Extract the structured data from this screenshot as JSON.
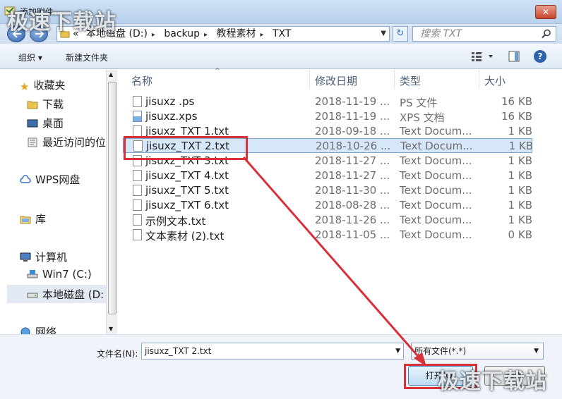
{
  "window": {
    "title": "添加附件",
    "close_label": "✕"
  },
  "address": {
    "overflow": "«",
    "crumbs": [
      "本地磁盘 (D:)",
      "backup",
      "教程素材",
      "TXT"
    ],
    "search_placeholder": "搜索 TXT"
  },
  "toolbar": {
    "organize": "组织 ▾",
    "new_folder": "新建文件夹"
  },
  "nav": {
    "favorites": "收藏夹",
    "downloads": "下载",
    "desktop": "桌面",
    "recent": "最近访问的位",
    "wps": "WPS网盘",
    "libraries": "库",
    "computer": "计算机",
    "drive_c": "Win7 (C:)",
    "drive_d": "本地磁盘 (D:",
    "network": "网络"
  },
  "columns": {
    "name": "名称",
    "date": "修改日期",
    "type": "类型",
    "size": "大小"
  },
  "files": [
    {
      "name": "jisuxz .ps",
      "date": "2018-11-19 ...",
      "type": "PS 文件",
      "size": "16 KB",
      "icon": "file-icon"
    },
    {
      "name": "jisuxz.xps",
      "date": "2018-11-19 ...",
      "type": "XPS 文档",
      "size": "16 KB",
      "icon": "image-file-icon"
    },
    {
      "name": "jisuxz_TXT 1.txt",
      "date": "2018-09-18 ...",
      "type": "Text Docum...",
      "size": "1 KB",
      "icon": "text-file-icon"
    },
    {
      "name": "jisuxz_TXT 2.txt",
      "date": "2018-10-26 ...",
      "type": "Text Docum...",
      "size": "1 KB",
      "icon": "text-file-icon"
    },
    {
      "name": "jisuxz_TXT 3.txt",
      "date": "2018-11-27 ...",
      "type": "Text Docum...",
      "size": "1 KB",
      "icon": "text-file-icon"
    },
    {
      "name": "jisuxz_TXT 4.txt",
      "date": "2018-11-27 ...",
      "type": "Text Docum...",
      "size": "1 KB",
      "icon": "text-file-icon"
    },
    {
      "name": "jisuxz_TXT 5.txt",
      "date": "2018-11-30 ...",
      "type": "Text Docum...",
      "size": "1 KB",
      "icon": "text-file-icon"
    },
    {
      "name": "jisuxz_TXT 6.txt",
      "date": "2018-08-28 ...",
      "type": "Text Docum...",
      "size": "1 KB",
      "icon": "text-file-icon"
    },
    {
      "name": "示例文本.txt",
      "date": "2018-11-26 ...",
      "type": "Text Docum...",
      "size": "1 KB",
      "icon": "text-file-icon"
    },
    {
      "name": "文本素材 (2).txt",
      "date": "2018-11-05 ...",
      "type": "Text Docum...",
      "size": "0 KB",
      "icon": "text-file-icon"
    }
  ],
  "selected_file_index": 3,
  "bottom": {
    "filename_label": "文件名(N):",
    "filename_value": "jisuxz_TXT 2.txt",
    "filter_value": "所有文件(*.*)",
    "open_label": "打开(O)",
    "cancel_label": "取消"
  },
  "watermark": {
    "text": "极速下载站"
  },
  "colors": {
    "highlight_red": "#d8313a",
    "selection_blue": "#d7e7fa"
  }
}
